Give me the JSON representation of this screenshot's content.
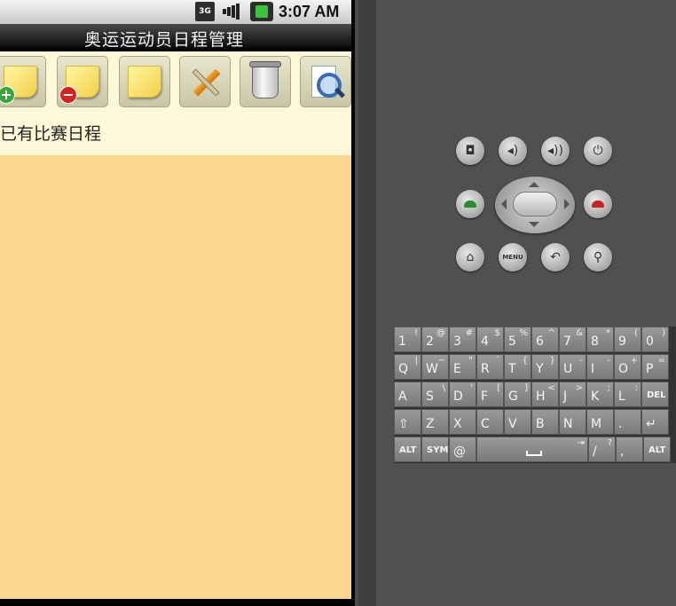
{
  "status_bar": {
    "network": "3G",
    "time": "3:07 AM"
  },
  "app": {
    "title": "奥运运动员日程管理",
    "toolbar": [
      {
        "name": "add-note-button",
        "icon": "note-add-icon"
      },
      {
        "name": "delete-note-button",
        "icon": "note-remove-icon"
      },
      {
        "name": "note-button",
        "icon": "note-icon"
      },
      {
        "name": "edit-button",
        "icon": "pencil-ruler-icon"
      },
      {
        "name": "trash-button",
        "icon": "trash-icon"
      },
      {
        "name": "search-button",
        "icon": "magnifier-icon"
      }
    ],
    "section_label": "已有比赛日程",
    "list_background": "#fbd68e"
  },
  "emulator": {
    "hardware_buttons": [
      "camera",
      "volume-down",
      "volume-up",
      "power",
      "call",
      "dpad",
      "end-call",
      "home",
      "menu",
      "back",
      "search"
    ],
    "menu_label": "MENU",
    "keyboard": {
      "row1": [
        [
          "1",
          "!"
        ],
        [
          "2",
          "@"
        ],
        [
          "3",
          "#"
        ],
        [
          "4",
          "$"
        ],
        [
          "5",
          "%"
        ],
        [
          "6",
          "^"
        ],
        [
          "7",
          "&"
        ],
        [
          "8",
          "*"
        ],
        [
          "9",
          "("
        ],
        [
          "0",
          ")"
        ]
      ],
      "row2": [
        [
          "Q",
          "|"
        ],
        [
          "W",
          "~"
        ],
        [
          "E",
          "\""
        ],
        [
          "R",
          "`"
        ],
        [
          "T",
          "{"
        ],
        [
          "Y",
          "}"
        ],
        [
          "U",
          "-"
        ],
        [
          "I",
          "-"
        ],
        [
          "O",
          "+"
        ],
        [
          "P",
          "="
        ]
      ],
      "row3": [
        [
          "A",
          ""
        ],
        [
          "S",
          "\\"
        ],
        [
          "D",
          "'"
        ],
        [
          "F",
          "["
        ],
        [
          "G",
          "]"
        ],
        [
          "H",
          "<"
        ],
        [
          "J",
          ">"
        ],
        [
          "K",
          ";"
        ],
        [
          "L",
          ":"
        ],
        [
          "DEL",
          ""
        ]
      ],
      "row4": [
        [
          "⇧",
          ""
        ],
        [
          "Z",
          ""
        ],
        [
          "X",
          ""
        ],
        [
          "C",
          ""
        ],
        [
          "V",
          ""
        ],
        [
          "B",
          ""
        ],
        [
          "N",
          ""
        ],
        [
          "M",
          ""
        ],
        [
          ".",
          ""
        ],
        [
          "↵",
          ""
        ]
      ],
      "row5": [
        [
          "ALT",
          ""
        ],
        [
          "SYM",
          ""
        ],
        [
          "@",
          ""
        ],
        [
          "␣",
          "⇥"
        ],
        [
          "/",
          "?"
        ],
        [
          ",",
          ""
        ],
        [
          "ALT",
          ""
        ]
      ]
    }
  }
}
